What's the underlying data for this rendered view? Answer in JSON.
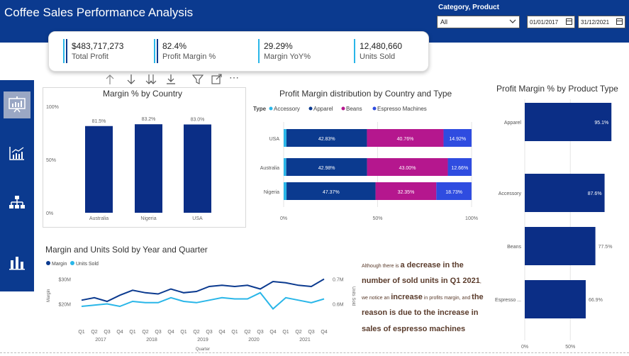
{
  "report": {
    "title": "Coffee Sales Performance Analysis"
  },
  "slicer": {
    "label": "Category, Product",
    "value": "All"
  },
  "date_range": {
    "start": "01/01/2017",
    "end": "31/12/2021"
  },
  "kpis": [
    {
      "value": "$483,717,273",
      "label": "Total Profit"
    },
    {
      "value": "82.4%",
      "label": "Profit Margin %"
    },
    {
      "value": "29.29%",
      "label": "Margin YoY%"
    },
    {
      "value": "12,480,660",
      "label": "Units Sold"
    }
  ],
  "sidebar": {
    "items": [
      "presentation-icon",
      "line-chart-icon",
      "hierarchy-icon",
      "bar-chart-icon"
    ]
  },
  "toolbar": {
    "icons": [
      "drill-up-icon",
      "drill-down-icon",
      "expand-all-icon",
      "expand-next-icon",
      "filter-icon",
      "focus-mode-icon",
      "more-options-icon"
    ],
    "more_glyph": "⋯"
  },
  "narrative": [
    {
      "text": "Although there is ",
      "style": "sm"
    },
    {
      "text": "a decrease in the number of sold units in Q1 2021",
      "style": "lg"
    },
    {
      "text": ", we notice an ",
      "style": "sm"
    },
    {
      "text": "increase",
      "style": "lg"
    },
    {
      "text": " in profits margin",
      "style": "sm"
    },
    {
      "text": ", and ",
      "style": "sm"
    },
    {
      "text": "the reason is due to the increase in sales of espresso machines",
      "style": "lg"
    }
  ],
  "colors": {
    "navy": "#0b3a8f",
    "light_blue": "#29b6e8",
    "magenta": "#b5178e",
    "blue": "#2f4ce0",
    "gray_bar": "#0b2e86"
  },
  "chart_data": [
    {
      "type": "bar",
      "title": "Margin % by Country",
      "categories": [
        "Australia",
        "Nigeria",
        "USA"
      ],
      "values": [
        81.5,
        83.2,
        83.0
      ],
      "data_labels": [
        "81.5%",
        "83.2%",
        "83.0%"
      ],
      "y_ticks": [
        "100%",
        "50%",
        "0%"
      ],
      "ylim": [
        0,
        100
      ]
    },
    {
      "type": "bar",
      "orientation": "horizontal-stacked-100",
      "title": "Profit Margin distribution by Country and Type",
      "legend_title": "Type",
      "categories": [
        "USA",
        "Australia",
        "Nigeria"
      ],
      "series": [
        {
          "name": "Accessory",
          "values": [
            1.49,
            1.39,
            1.53
          ],
          "labels": [
            "",
            "",
            ""
          ]
        },
        {
          "name": "Apparel",
          "values": [
            42.83,
            42.98,
            47.37
          ],
          "labels": [
            "42.83%",
            "42.98%",
            "47.37%"
          ]
        },
        {
          "name": "Beans",
          "values": [
            40.76,
            43.0,
            32.35
          ],
          "labels": [
            "40.76%",
            "43.00%",
            "32.35%"
          ]
        },
        {
          "name": "Espresso Machines",
          "values": [
            14.92,
            12.66,
            18.73
          ],
          "labels": [
            "14.92%",
            "12.66%",
            "18.73%"
          ]
        }
      ],
      "x_ticks": [
        "0%",
        "50%",
        "100%"
      ]
    },
    {
      "type": "bar",
      "orientation": "horizontal",
      "title": "Profit Margin % by Product Type",
      "categories": [
        "Apparel",
        "Accessory",
        "Beans",
        "Espresso ..."
      ],
      "values": [
        95.1,
        87.6,
        77.5,
        66.9
      ],
      "data_labels": [
        "95.1%",
        "87.6%",
        "77.5%",
        "66.9%"
      ],
      "x_ticks": [
        "0%",
        "50%"
      ],
      "xlim": [
        0,
        100
      ]
    },
    {
      "type": "line",
      "title": "Margin and Units Sold by Year and Quarter",
      "x": [
        "Q1",
        "Q2",
        "Q3",
        "Q4",
        "Q1",
        "Q2",
        "Q3",
        "Q4",
        "Q1",
        "Q2",
        "Q3",
        "Q4",
        "Q1",
        "Q2",
        "Q3",
        "Q4",
        "Q1",
        "Q2",
        "Q3",
        "Q4"
      ],
      "year_labels": [
        "2017",
        "2018",
        "2019",
        "2020",
        "2021"
      ],
      "xlabel": "Quarter",
      "ylabel_left": "Margin",
      "ylabel_right": "Units Sold",
      "left_ticks": [
        "$30M",
        "$20M"
      ],
      "right_ticks": [
        "0.7M",
        "0.6M"
      ],
      "left_range": [
        15,
        35
      ],
      "right_range": [
        0.55,
        0.75
      ],
      "series": [
        {
          "name": "Margin",
          "axis": "left",
          "values": [
            21.5,
            22.5,
            21.0,
            23.5,
            25.5,
            24.5,
            24.0,
            26.0,
            24.5,
            25.0,
            27.0,
            27.5,
            27.0,
            27.5,
            26.0,
            29.0,
            28.5,
            27.5,
            27.0,
            30.0
          ]
        },
        {
          "name": "Units Sold",
          "axis": "right",
          "values": [
            0.59,
            0.595,
            0.6,
            0.59,
            0.61,
            0.605,
            0.605,
            0.625,
            0.61,
            0.605,
            0.615,
            0.625,
            0.62,
            0.62,
            0.645,
            0.58,
            0.625,
            0.615,
            0.605,
            0.62
          ]
        }
      ]
    }
  ]
}
